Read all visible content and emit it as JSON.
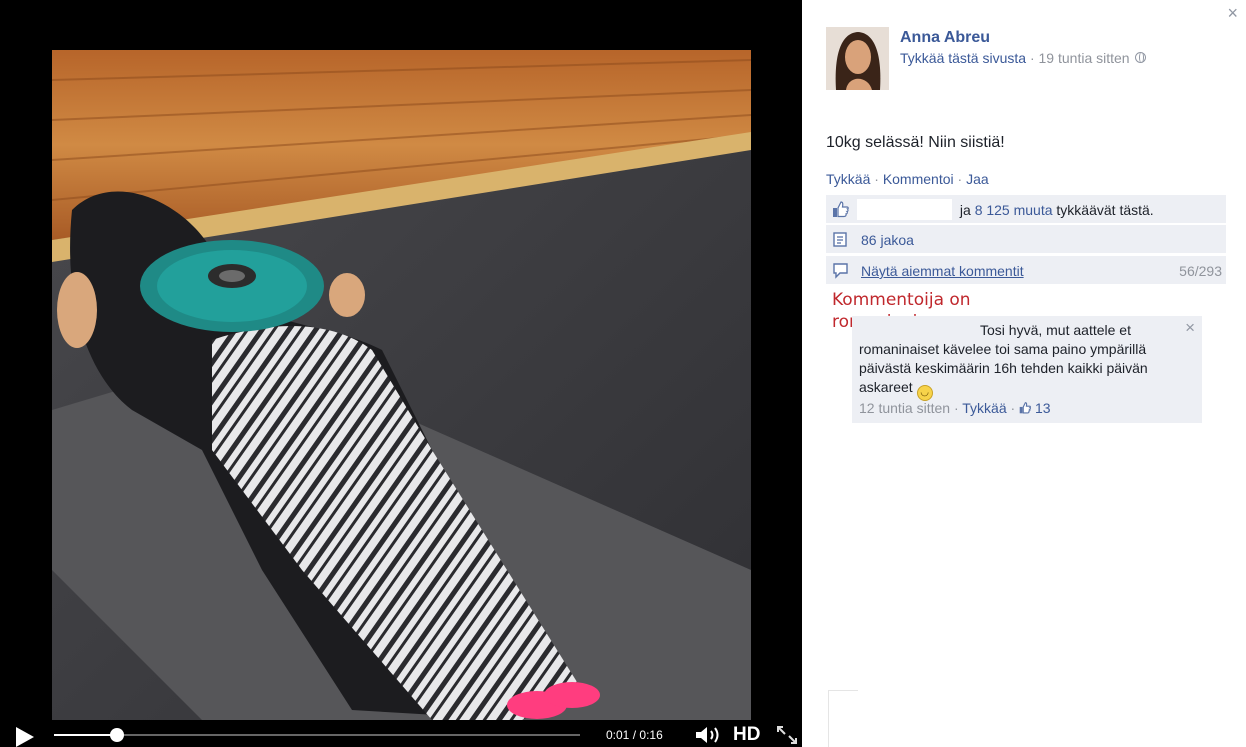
{
  "video": {
    "time_current": "0:01",
    "time_separator": "/",
    "time_total": "0:16",
    "progress_fraction": 0.12,
    "hd_label": "HD",
    "play_icon": "play-icon",
    "volume_icon": "volume-icon",
    "fullscreen_icon": "fullscreen-icon"
  },
  "post": {
    "author": "Anna Abreu",
    "like_page": "Tykkää tästä sivusta",
    "separator": "·",
    "time": "19 tuntia sitten",
    "privacy_icon": "globe-icon",
    "text": "10kg selässä! Niin siistiä!",
    "actions": {
      "like": "Tykkää",
      "comment": "Kommentoi",
      "share": "Jaa"
    },
    "likes_prefix": "ja",
    "likes_link": "8 125 muuta",
    "likes_suffix": "tykkäävät tästä.",
    "shares": "86 jakoa",
    "prev_comments": "Näytä aiemmat kommentit",
    "comment_count": "56/293"
  },
  "annotation": {
    "line1": "Kommentoija on",
    "line2": "romaninainen:"
  },
  "comment": {
    "text": "Tosi hyvä, mut aattele et romaninaiset kävelee toi sama paino ympärillä päivästä keskimäärin 16h tehden kaikki päivän askareet",
    "emoji": "smiley-icon",
    "time": "12 tuntia sitten",
    "like": "Tykkää",
    "likes": "13"
  },
  "close_label": "×",
  "colors": {
    "link": "#3b5998",
    "annotation": "#c0282d",
    "row_bg": "#edeff4",
    "meta": "#90949c"
  }
}
